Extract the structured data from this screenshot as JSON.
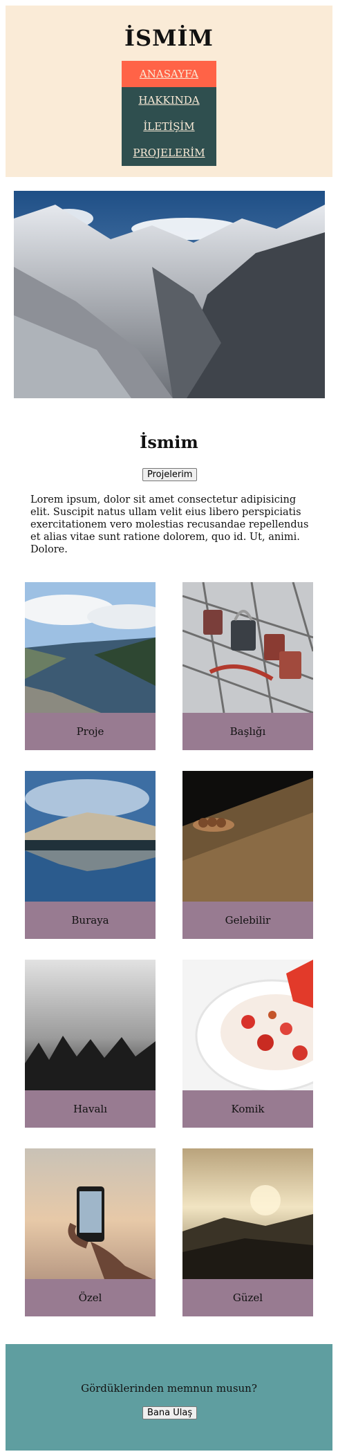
{
  "header": {
    "site_title": "İSMİM",
    "nav": [
      {
        "label": "ANASAYFA",
        "active": true
      },
      {
        "label": "HAKKINDA",
        "active": false
      },
      {
        "label": "İLETİŞİM",
        "active": false
      },
      {
        "label": "PROJELERİM",
        "active": false
      }
    ]
  },
  "hero": {
    "image": "mountain-valley-photo"
  },
  "intro": {
    "title": "İsmim",
    "button_label": "Projelerim",
    "text": "Lorem ipsum, dolor sit amet consectetur adipisicing elit. Suscipit natus ullam velit eius libero perspiciatis exercitationem vero molestias recusandae repellendus et alias vitae sunt ratione dolorem, quo id. Ut, animi. Dolore."
  },
  "gallery": [
    {
      "caption": "Proje",
      "image": "fjord-photo"
    },
    {
      "caption": "Başlığı",
      "image": "padlocks-photo"
    },
    {
      "caption": "Buraya",
      "image": "lake-reflection-photo"
    },
    {
      "caption": "Gelebilir",
      "image": "wood-nuts-photo"
    },
    {
      "caption": "Havalı",
      "image": "foggy-forest-photo"
    },
    {
      "caption": "Komik",
      "image": "strawberry-bowl-photo"
    },
    {
      "caption": "Özel",
      "image": "phone-beach-photo"
    },
    {
      "caption": "Güzel",
      "image": "sunset-hills-photo"
    }
  ],
  "footer": {
    "text": "Gördüklerinden memnun musun?",
    "button_label": "Bana Ulaş"
  },
  "colors": {
    "header_bg": "#faebd7",
    "nav_bg": "#2f4f4f",
    "nav_active_bg": "#ff6347",
    "caption_bg": "#987b91",
    "footer_bg": "#5f9ea0"
  }
}
